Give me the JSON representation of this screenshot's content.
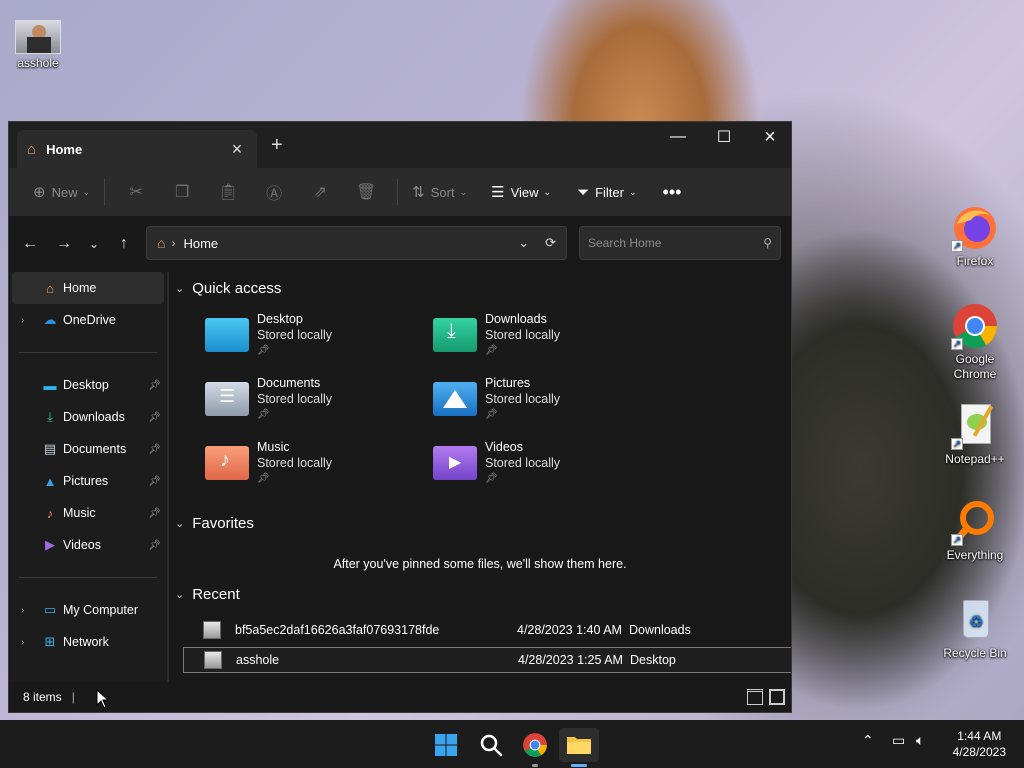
{
  "desktop": {
    "icons": [
      {
        "label": "asshole"
      },
      {
        "label": "Firefox"
      },
      {
        "label": "Google Chrome"
      },
      {
        "label": "Notepad++"
      },
      {
        "label": "Everything"
      },
      {
        "label": "Recycle Bin"
      }
    ]
  },
  "window": {
    "tab_title": "Home",
    "toolbar": {
      "new_label": "New",
      "sort_label": "Sort",
      "view_label": "View",
      "filter_label": "Filter"
    },
    "address": {
      "crumb": "Home",
      "search_placeholder": "Search Home"
    },
    "sidebar": {
      "top": [
        {
          "label": "Home"
        },
        {
          "label": "OneDrive"
        }
      ],
      "pinned": [
        {
          "label": "Desktop"
        },
        {
          "label": "Downloads"
        },
        {
          "label": "Documents"
        },
        {
          "label": "Pictures"
        },
        {
          "label": "Music"
        },
        {
          "label": "Videos"
        }
      ],
      "bottom": [
        {
          "label": "My Computer"
        },
        {
          "label": "Network"
        }
      ]
    },
    "quick_access": {
      "heading": "Quick access",
      "items": [
        {
          "name": "Desktop",
          "status": "Stored locally"
        },
        {
          "name": "Downloads",
          "status": "Stored locally"
        },
        {
          "name": "Documents",
          "status": "Stored locally"
        },
        {
          "name": "Pictures",
          "status": "Stored locally"
        },
        {
          "name": "Music",
          "status": "Stored locally"
        },
        {
          "name": "Videos",
          "status": "Stored locally"
        }
      ]
    },
    "favorites": {
      "heading": "Favorites",
      "empty_text": "After you've pinned some files, we'll show them here."
    },
    "recent": {
      "heading": "Recent",
      "rows": [
        {
          "name": "bf5a5ec2daf16626a3faf07693178fde",
          "date": "4/28/2023 1:40 AM",
          "location": "Downloads"
        },
        {
          "name": "asshole",
          "date": "4/28/2023 1:25 AM",
          "location": "Desktop"
        }
      ]
    },
    "status": {
      "count": "8 items"
    }
  },
  "taskbar": {
    "time": "1:44 AM",
    "date": "4/28/2023"
  },
  "colors": {
    "window_bg": "#191919",
    "cmdbar_bg": "#2b2b2b",
    "taskbar_bg": "#1c1c1c",
    "accent": "#0078d4"
  }
}
